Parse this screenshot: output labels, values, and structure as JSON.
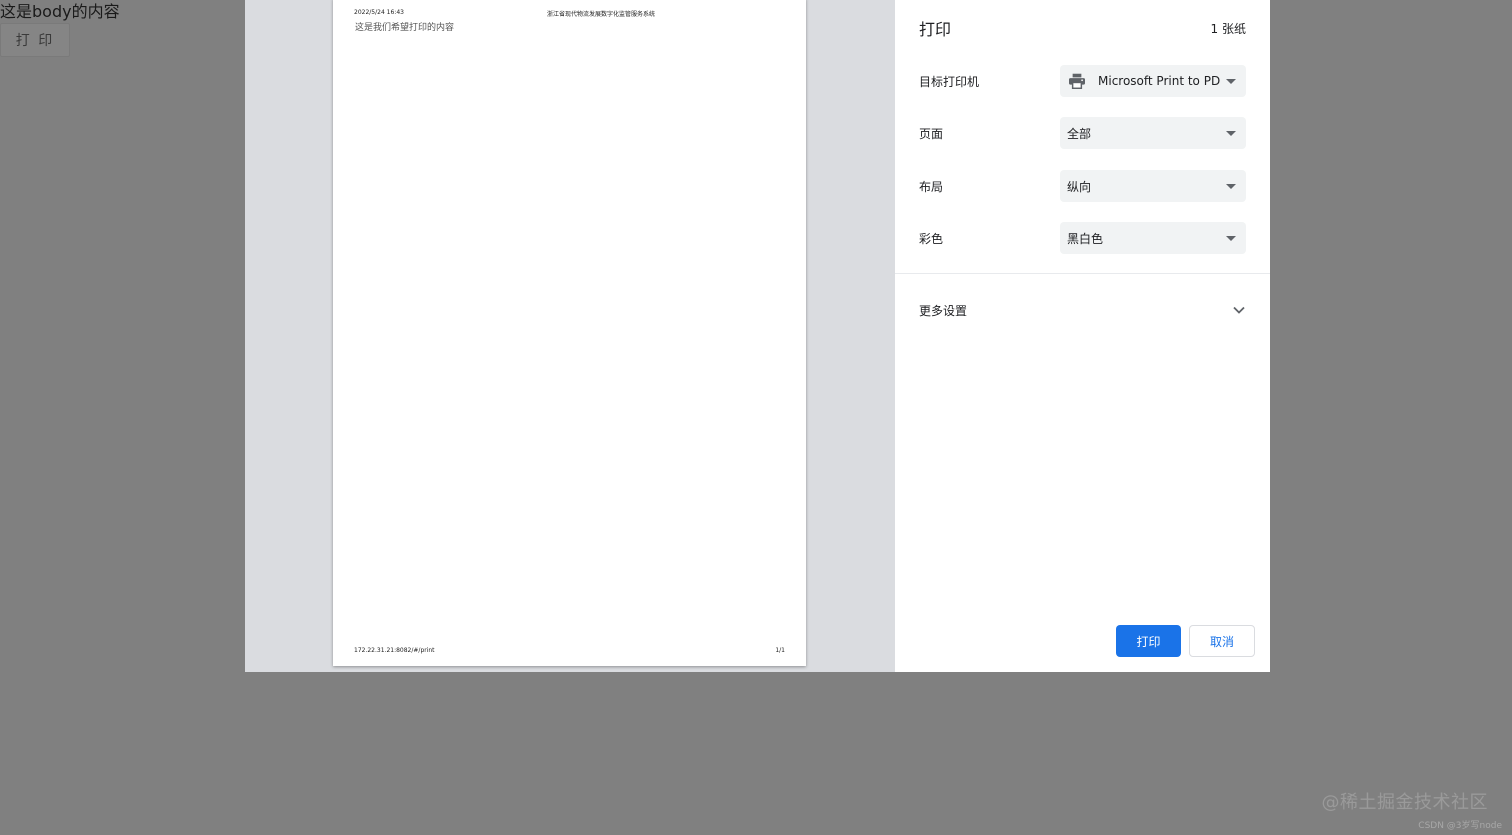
{
  "background_page": {
    "body_text": "这是body的内容",
    "print_button_label": "打 印"
  },
  "preview": {
    "header_date": "2022/5/24 16:43",
    "header_title": "浙江省现代物流发展数字化监管服务系统",
    "content_text": "这是我们希望打印的内容",
    "footer_url": "172.22.31.21:8082/#/print",
    "footer_page": "1/1"
  },
  "sidebar": {
    "title": "打印",
    "sheet_count": "1 张纸",
    "destination": {
      "label": "目标打印机",
      "value": "Microsoft Print to PDF",
      "icon": "printer-icon"
    },
    "pages": {
      "label": "页面",
      "value": "全部"
    },
    "layout": {
      "label": "布局",
      "value": "纵向"
    },
    "color": {
      "label": "彩色",
      "value": "黑白色"
    },
    "more_settings": {
      "label": "更多设置",
      "icon": "chevron-down-icon"
    },
    "print_button": "打印",
    "cancel_button": "取消"
  },
  "watermark": {
    "main": "@稀土掘金技术社区",
    "sub": "CSDN @3岁写node"
  },
  "colors": {
    "accent": "#1a73e8",
    "overlay": "#808080",
    "preview_bg": "#dadce0",
    "select_bg": "#f1f3f4"
  }
}
